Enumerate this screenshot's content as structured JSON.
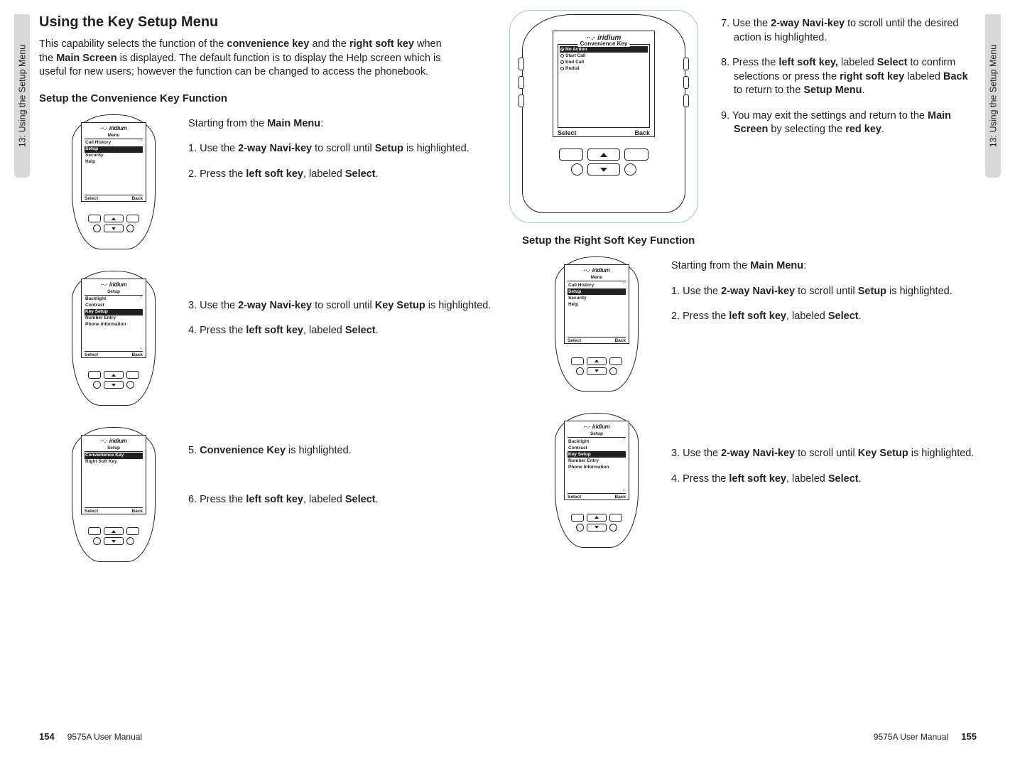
{
  "side_tab": "13: Using the Setup Menu",
  "footer_doc": "9575A User Manual",
  "page_left_num": "154",
  "page_right_num": "155",
  "left": {
    "title": "Using the Key Setup Menu",
    "intro_a": "This capability selects the function of the ",
    "intro_b1": "convenience key",
    "intro_c": " and the ",
    "intro_b2": "right soft key",
    "intro_d": " when the ",
    "intro_b3": "Main Screen",
    "intro_e": " is displayed. The default function is to display the Help screen which is useful for new users; however the function can be changed to access the phonebook.",
    "sub1": "Setup the Convenience Key Function",
    "lead1": "Starting from the ",
    "lead1b": "Main Menu",
    "step1_a": "1. Use the ",
    "step1_b": "2-way Navi-key",
    "step1_c": " to scroll until ",
    "step1_d": "Setup",
    "step1_e": " is highlighted.",
    "step2_a": "2. Press the ",
    "step2_b": "left soft key",
    "step2_c": ", labeled ",
    "step2_d": "Select",
    "step3_a": "3. Use the ",
    "step3_b": "2-way Navi-key",
    "step3_c": " to scroll until ",
    "step3_d": "Key Setup",
    "step3_e": " is highlighted.",
    "step4_a": "4. Press the ",
    "step4_b": "left soft key",
    "step4_c": ", labeled ",
    "step4_d": "Select",
    "step5_a": "5. ",
    "step5_b": "Convenience Key",
    "step5_c": " is highlighted.",
    "step6_a": "6. Press the ",
    "step6_b": "left soft key",
    "step6_c": ", labeled ",
    "step6_d": "Select"
  },
  "right": {
    "step7_a": "7. Use the ",
    "step7_b": "2-way Navi-key",
    "step7_c": " to scroll until the desired action is highlighted.",
    "step8_a": "8. Press the ",
    "step8_b": "left soft key,",
    "step8_c": " labeled ",
    "step8_d": "Select",
    "step8_e": " to confirm selections or press the ",
    "step8_f": "right soft key",
    "step8_g": " labeled ",
    "step8_h": "Back",
    "step8_i": " to return to the ",
    "step8_j": "Setup Menu",
    "step9_a": "9. You may exit the settings and return to the ",
    "step9_b": "Main Screen",
    "step9_c": " by selecting the ",
    "step9_d": "red key",
    "sub2": "Setup the Right Soft Key Function",
    "lead2a": "Starting from the ",
    "lead2b": "Main Menu",
    "r1_a": "1. Use the ",
    "r1_b": "2-way Navi-key",
    "r1_c": " to scroll until ",
    "r1_d": "Setup",
    "r1_e": " is highlighted.",
    "r2_a": "2. Press the ",
    "r2_b": "left soft key",
    "r2_c": ", labeled ",
    "r2_d": "Select",
    "r3_a": "3. Use the ",
    "r3_b": "2-way Navi-key",
    "r3_c": " to scroll until ",
    "r3_d": "Key Setup",
    "r3_e": " is highlighted.",
    "r4_a": "4. Press the ",
    "r4_b": "left soft key",
    "r4_c": ", labeled ",
    "r4_d": "Select"
  },
  "screens": {
    "brand": "iridium",
    "menu": "Menu",
    "setup": "Setup",
    "conv_key": "Convenience Key",
    "select": "Select",
    "back": "Back",
    "s1_items": [
      "Call History",
      "Setup",
      "Security",
      "Help"
    ],
    "s1_sel": 1,
    "s2_items": [
      "Backlight",
      "Contrast",
      "Key Setup",
      "Number Entry",
      "Phone Information"
    ],
    "s2_sel": 2,
    "s3_items": [
      "Convenience Key",
      "Right Soft Key"
    ],
    "s3_sel": 0,
    "s4_items": [
      "No Action",
      "Start Call",
      "End Call",
      "Redial"
    ],
    "s4_sel": 0
  }
}
